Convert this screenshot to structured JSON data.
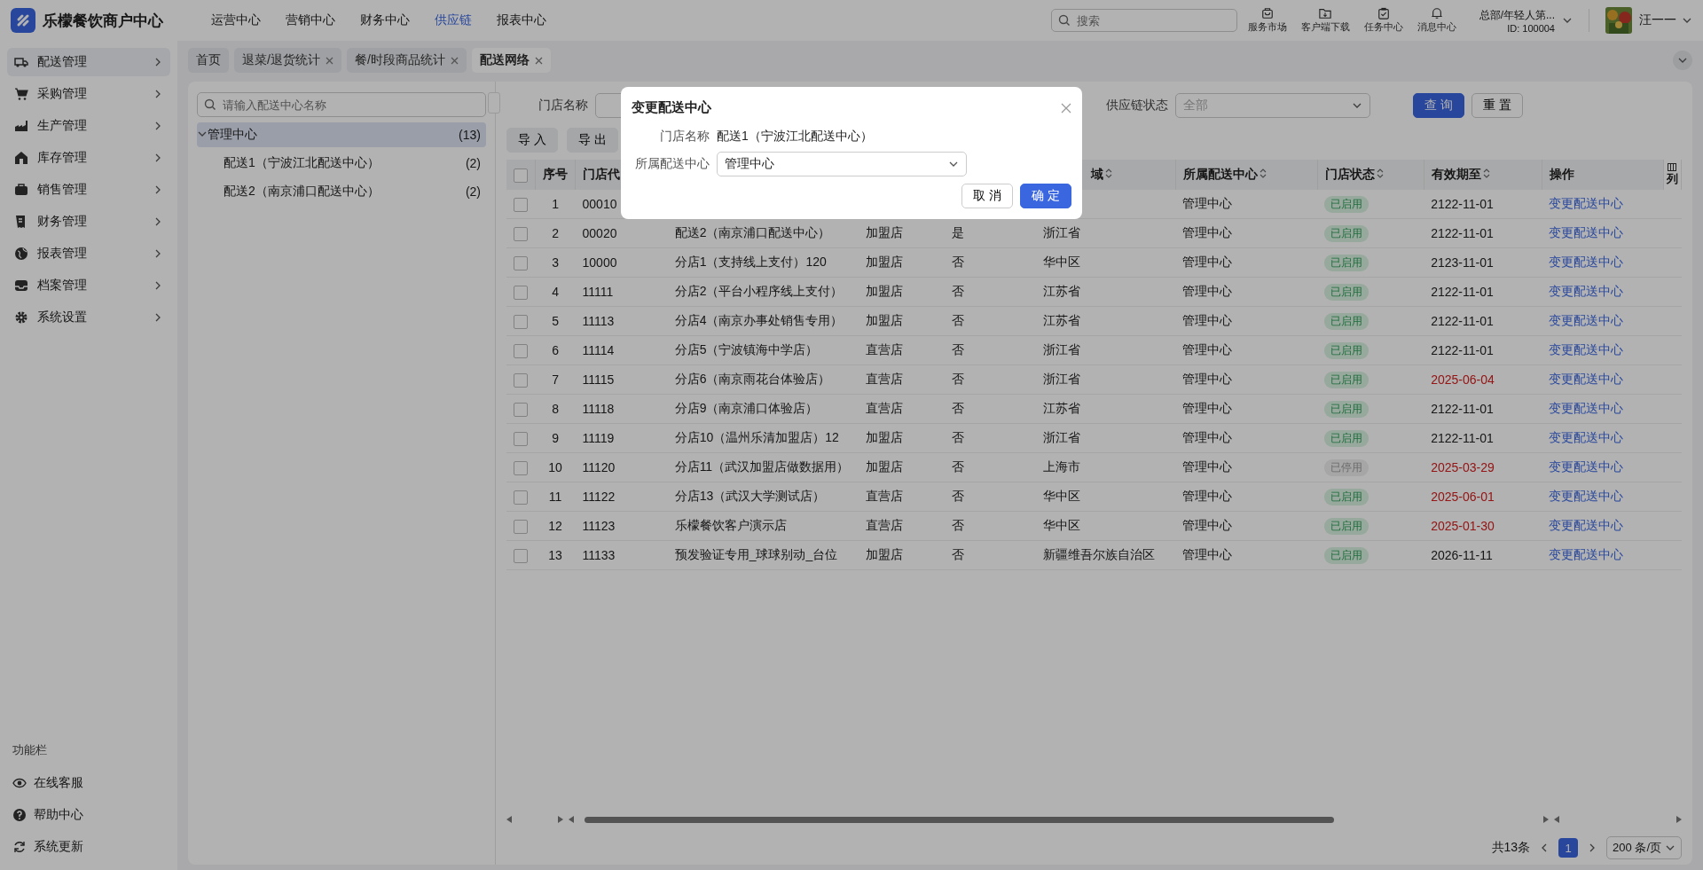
{
  "brand": {
    "name": "乐檬餐饮商户中心"
  },
  "top_nav": [
    {
      "label": "运营中心",
      "selected": false
    },
    {
      "label": "营销中心",
      "selected": false
    },
    {
      "label": "财务中心",
      "selected": false
    },
    {
      "label": "供应链",
      "selected": true
    },
    {
      "label": "报表中心",
      "selected": false
    }
  ],
  "search": {
    "placeholder": "搜索"
  },
  "tools": [
    {
      "label": "服务市场",
      "kind": "bag"
    },
    {
      "label": "客户端下载",
      "kind": "folder"
    },
    {
      "label": "任务中心",
      "kind": "clipboard"
    },
    {
      "label": "消息中心",
      "kind": "bell"
    }
  ],
  "account": {
    "org": "总部/年轻人第...",
    "id": "ID: 100004",
    "user": "汪一一"
  },
  "sidebar": {
    "items": [
      {
        "label": "配送管理",
        "kind": "truck",
        "selected": true
      },
      {
        "label": "采购管理",
        "kind": "cart",
        "selected": false
      },
      {
        "label": "生产管理",
        "kind": "factory",
        "selected": false
      },
      {
        "label": "库存管理",
        "kind": "house",
        "selected": false
      },
      {
        "label": "销售管理",
        "kind": "case",
        "selected": false
      },
      {
        "label": "财务管理",
        "kind": "receipt",
        "selected": false
      },
      {
        "label": "报表管理",
        "kind": "globe",
        "selected": false
      },
      {
        "label": "档案管理",
        "kind": "tray",
        "selected": false
      },
      {
        "label": "系统设置",
        "kind": "gear",
        "selected": false
      }
    ],
    "footer_title": "功能栏",
    "footer_items": [
      {
        "label": "在线客服",
        "kind": "eye"
      },
      {
        "label": "帮助中心",
        "kind": "help"
      },
      {
        "label": "系统更新",
        "kind": "refresh"
      }
    ]
  },
  "tabs": [
    {
      "label": "首页",
      "closable": false,
      "selected": false
    },
    {
      "label": "退菜/退货统计",
      "closable": true,
      "selected": false
    },
    {
      "label": "餐/时段商品统计",
      "closable": true,
      "selected": false
    },
    {
      "label": "配送网络",
      "closable": true,
      "selected": true
    }
  ],
  "tree": {
    "search_placeholder": "请输入配送中心名称",
    "nodes": [
      {
        "label": "管理中心",
        "count": "(13)",
        "expanded": true,
        "selected": true,
        "children": [
          {
            "label": "配送1（宁波江北配送中心）",
            "count": "(2)",
            "selected": false
          },
          {
            "label": "配送2（南京浦口配送中心）",
            "count": "(2)",
            "selected": false
          }
        ]
      }
    ]
  },
  "filters": {
    "store_label": "门店名称",
    "status_label": "供应链状态",
    "status_value": "全部",
    "query": "查 询",
    "reset": "重 置"
  },
  "actions": [
    "导 入",
    "导 出"
  ],
  "table": {
    "columns": [
      {
        "label": "序号",
        "sortable": false
      },
      {
        "label": "门店代",
        "sortable": false
      },
      {},
      {},
      {},
      {
        "label": "域",
        "sortable": true
      },
      {
        "label": "所属配送中心",
        "sortable": true
      },
      {
        "label": "门店状态",
        "sortable": true
      },
      {
        "label": "有效期至",
        "sortable": true
      },
      {
        "label": "操作",
        "sortable": false
      }
    ],
    "column_setting": "列",
    "all_checked": false,
    "rows": [
      {
        "checked": false,
        "no": "1",
        "code": "00010",
        "center": "管理中心",
        "status": "已启用",
        "active": true,
        "expiry": "2122-11-01",
        "expired": false,
        "action": "变更配送中心"
      },
      {
        "checked": false,
        "no": "2",
        "code": "00020",
        "name": "配送2（南京浦口配送中心）",
        "type": "加盟店",
        "is_center": "是",
        "region": "浙江省",
        "center": "管理中心",
        "status": "已启用",
        "active": true,
        "expiry": "2122-11-01",
        "expired": false,
        "action": "变更配送中心"
      },
      {
        "checked": false,
        "no": "3",
        "code": "10000",
        "name": "分店1（支持线上支付）120",
        "type": "加盟店",
        "is_center": "否",
        "region": "华中区",
        "center": "管理中心",
        "status": "已启用",
        "active": true,
        "expiry": "2123-11-01",
        "expired": false,
        "action": "变更配送中心"
      },
      {
        "checked": false,
        "no": "4",
        "code": "11111",
        "name": "分店2（平台小程序线上支付）",
        "type": "加盟店",
        "is_center": "否",
        "region": "江苏省",
        "center": "管理中心",
        "status": "已启用",
        "active": true,
        "expiry": "2122-11-01",
        "expired": false,
        "action": "变更配送中心"
      },
      {
        "checked": false,
        "no": "5",
        "code": "11113",
        "name": "分店4（南京办事处销售专用）",
        "type": "加盟店",
        "is_center": "否",
        "region": "江苏省",
        "center": "管理中心",
        "status": "已启用",
        "active": true,
        "expiry": "2122-11-01",
        "expired": false,
        "action": "变更配送中心"
      },
      {
        "checked": false,
        "no": "6",
        "code": "11114",
        "name": "分店5（宁波镇海中学店）",
        "type": "直营店",
        "is_center": "否",
        "region": "浙江省",
        "center": "管理中心",
        "status": "已启用",
        "active": true,
        "expiry": "2122-11-01",
        "expired": false,
        "action": "变更配送中心"
      },
      {
        "checked": false,
        "no": "7",
        "code": "11115",
        "name": "分店6（南京雨花台体验店）",
        "type": "直营店",
        "is_center": "否",
        "region": "浙江省",
        "center": "管理中心",
        "status": "已启用",
        "active": true,
        "expiry": "2025-06-04",
        "expired": true,
        "action": "变更配送中心"
      },
      {
        "checked": false,
        "no": "8",
        "code": "11118",
        "name": "分店9（南京浦口体验店）",
        "type": "直营店",
        "is_center": "否",
        "region": "江苏省",
        "center": "管理中心",
        "status": "已启用",
        "active": true,
        "expiry": "2122-11-01",
        "expired": false,
        "action": "变更配送中心"
      },
      {
        "checked": false,
        "no": "9",
        "code": "11119",
        "name": "分店10（温州乐清加盟店）12",
        "type": "加盟店",
        "is_center": "否",
        "region": "浙江省",
        "center": "管理中心",
        "status": "已启用",
        "active": true,
        "expiry": "2122-11-01",
        "expired": false,
        "action": "变更配送中心"
      },
      {
        "checked": false,
        "no": "10",
        "code": "11120",
        "name": "分店11（武汉加盟店做数据用）",
        "type": "加盟店",
        "is_center": "否",
        "region": "上海市",
        "center": "管理中心",
        "status": "已停用",
        "active": false,
        "expiry": "2025-03-29",
        "expired": true,
        "action": "变更配送中心"
      },
      {
        "checked": false,
        "no": "11",
        "code": "11122",
        "name": "分店13（武汉大学测试店）",
        "type": "直营店",
        "is_center": "否",
        "region": "华中区",
        "center": "管理中心",
        "status": "已启用",
        "active": true,
        "expiry": "2025-06-01",
        "expired": true,
        "action": "变更配送中心"
      },
      {
        "checked": false,
        "no": "12",
        "code": "11123",
        "name": "乐檬餐饮客户演示店",
        "type": "直营店",
        "is_center": "否",
        "region": "华中区",
        "center": "管理中心",
        "status": "已启用",
        "active": true,
        "expiry": "2025-01-30",
        "expired": true,
        "action": "变更配送中心"
      },
      {
        "checked": false,
        "no": "13",
        "code": "11133",
        "name": "预发验证专用_球球别动_台位",
        "type": "加盟店",
        "is_center": "否",
        "region": "新疆维吾尔族自治区",
        "center": "管理中心",
        "status": "已启用",
        "active": true,
        "expiry": "2026-11-11",
        "expired": false,
        "action": "变更配送中心"
      }
    ]
  },
  "pagination": {
    "total": "共13条",
    "pages": [
      {
        "label": "1",
        "selected": true
      }
    ],
    "page_size": "200 条/页"
  },
  "dialog": {
    "title": "变更配送中心",
    "fields": [
      {
        "label": "门店名称",
        "kind": "text",
        "value": "配送1（宁波江北配送中心）"
      },
      {
        "label": "所属配送中心",
        "kind": "select",
        "value": "管理中心"
      }
    ],
    "cancel": "取 消",
    "confirm": "确 定"
  }
}
